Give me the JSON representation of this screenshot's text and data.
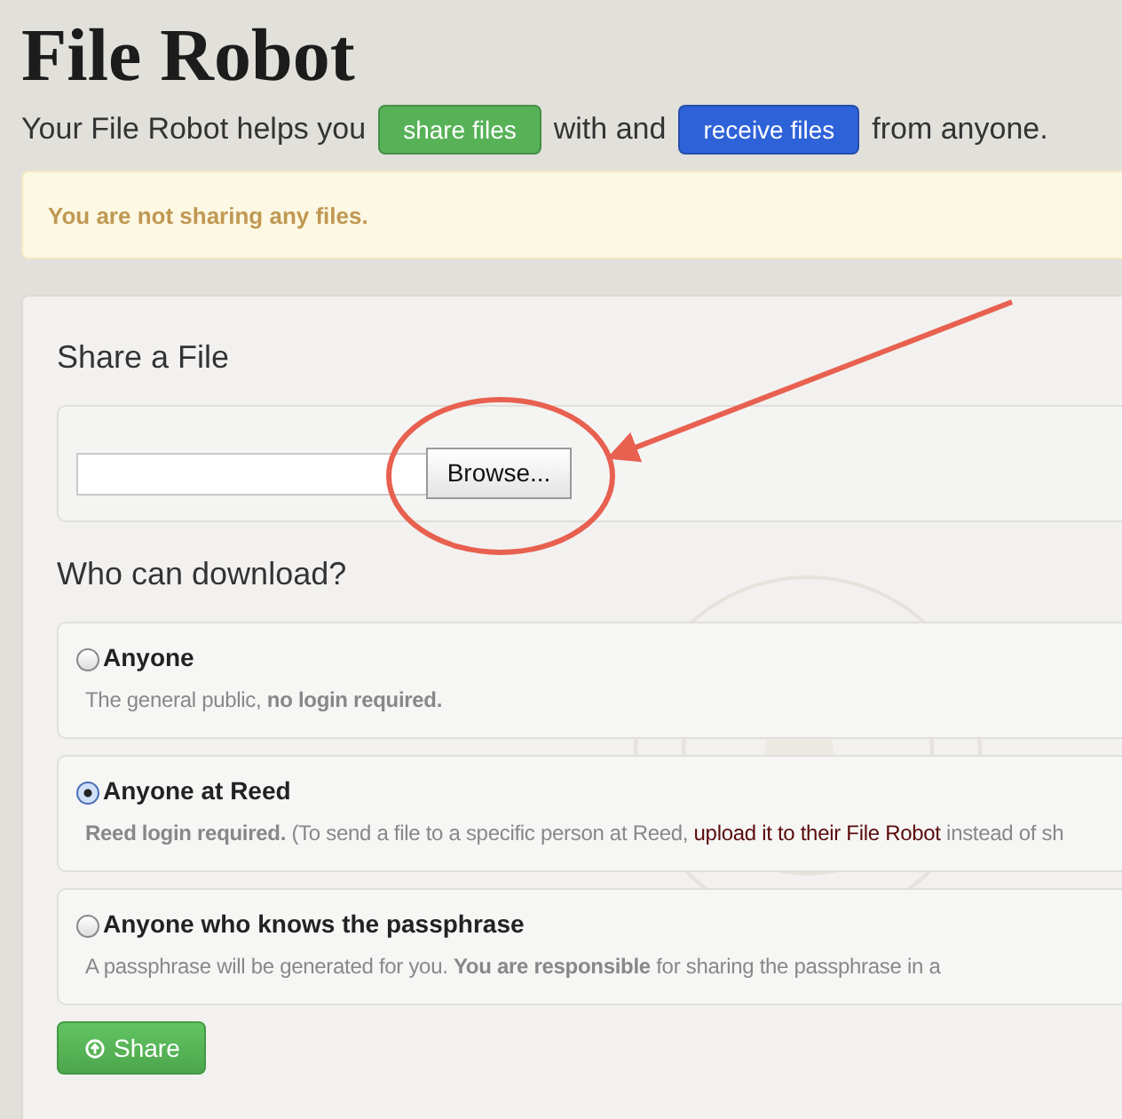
{
  "title": "File Robot",
  "tagline": [
    {
      "kind": "text",
      "text": "Your File Robot helps you"
    },
    {
      "kind": "button",
      "text": "share files",
      "color": "#57b257"
    },
    {
      "kind": "text",
      "text": "with and"
    },
    {
      "kind": "button",
      "text": "receive files",
      "color": "#2e62d8"
    },
    {
      "kind": "text",
      "text": "from anyone."
    }
  ],
  "alert": "You are not sharing any files.",
  "share_panel": {
    "heading": "Share a File",
    "file_field": {
      "button": "Browse..."
    },
    "access_heading": "Who can download?",
    "options": [
      {
        "label": "Anyone",
        "selected": false,
        "description": [
          {
            "kind": "text",
            "text": "The general public, **no login required.**"
          }
        ]
      },
      {
        "label": "Anyone at Reed",
        "selected": true,
        "description": [
          {
            "kind": "text",
            "text": "**Reed login required.** (To send a file to a specific person at Reed,"
          },
          {
            "kind": "link",
            "text": "upload it to their File Robot"
          },
          {
            "kind": "text",
            "text": "instead of sh"
          }
        ]
      },
      {
        "label": "Anyone who knows the passphrase",
        "selected": false,
        "description": [
          {
            "kind": "text",
            "text": "A passphrase will be generated for you. **You are responsible** for sharing the passphrase in a"
          }
        ]
      }
    ],
    "submit": "Share"
  }
}
